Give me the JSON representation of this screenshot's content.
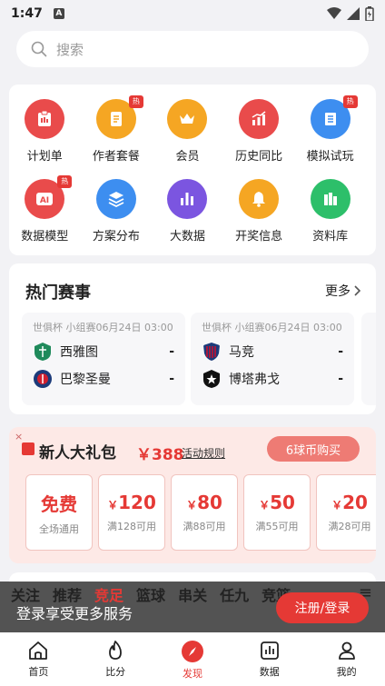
{
  "status": {
    "time": "1:47",
    "notif_badge": "A"
  },
  "search": {
    "placeholder": "搜索"
  },
  "grid": [
    {
      "label": "计划单",
      "icon": "clipboard-icon",
      "color": "#e94b4b",
      "hot": false
    },
    {
      "label": "作者套餐",
      "icon": "document-icon",
      "color": "#f5a623",
      "hot": true
    },
    {
      "label": "会员",
      "icon": "crown-icon",
      "color": "#f5a623",
      "hot": false
    },
    {
      "label": "历史同比",
      "icon": "trend-chart-icon",
      "color": "#e94b4b",
      "hot": false
    },
    {
      "label": "模拟试玩",
      "icon": "book-icon",
      "color": "#3d8ef0",
      "hot": true
    },
    {
      "label": "数据模型",
      "icon": "ai-icon",
      "color": "#e94b4b",
      "hot": true
    },
    {
      "label": "方案分布",
      "icon": "layers-icon",
      "color": "#3d8ef0",
      "hot": false
    },
    {
      "label": "大数据",
      "icon": "bar-chart-icon",
      "color": "#7b55e0",
      "hot": false
    },
    {
      "label": "开奖信息",
      "icon": "bell-icon",
      "color": "#f5a623",
      "hot": false
    },
    {
      "label": "资料库",
      "icon": "library-icon",
      "color": "#2dbf6a",
      "hot": false
    }
  ],
  "hot_tag": "热",
  "hot_matches": {
    "title": "热门赛事",
    "more": "更多",
    "matches": [
      {
        "meta": "世俱杯 小组赛06月24日 03:00",
        "home": "西雅图",
        "away": "巴黎圣曼",
        "home_score": "-",
        "away_score": "-",
        "home_color": "#1f8a5b",
        "away_color": "#1c3b7a"
      },
      {
        "meta": "世俱杯 小组赛06月24日 03:00",
        "home": "马竞",
        "away": "博塔弗戈",
        "home_score": "-",
        "away_score": "-",
        "home_color": "#c8102e",
        "away_color": "#111111"
      }
    ]
  },
  "gift": {
    "close": "×",
    "title": "新人大礼包",
    "price": "￥388",
    "rules": "活动规则",
    "buy": "6球币购买",
    "coupons": [
      {
        "amount": "免费",
        "cond": "全场通用"
      },
      {
        "currency": "￥",
        "amount": "120",
        "cond": "满128可用"
      },
      {
        "currency": "￥",
        "amount": "80",
        "cond": "满88可用"
      },
      {
        "currency": "￥",
        "amount": "50",
        "cond": "满55可用"
      },
      {
        "currency": "￥",
        "amount": "20",
        "cond": "满28可用"
      }
    ]
  },
  "overlay": {
    "tabs": [
      "关注",
      "推荐",
      "竞足",
      "篮球",
      "串关",
      "任九",
      "竞篮"
    ],
    "active_tab": "竞足",
    "message": "登录享受更多服务",
    "register": "注册/登录"
  },
  "nav": [
    {
      "label": "首页",
      "icon": "home-icon"
    },
    {
      "label": "比分",
      "icon": "flame-icon"
    },
    {
      "label": "发现",
      "icon": "compass-icon",
      "active": true
    },
    {
      "label": "数据",
      "icon": "data-chart-icon"
    },
    {
      "label": "我的",
      "icon": "user-icon"
    }
  ]
}
